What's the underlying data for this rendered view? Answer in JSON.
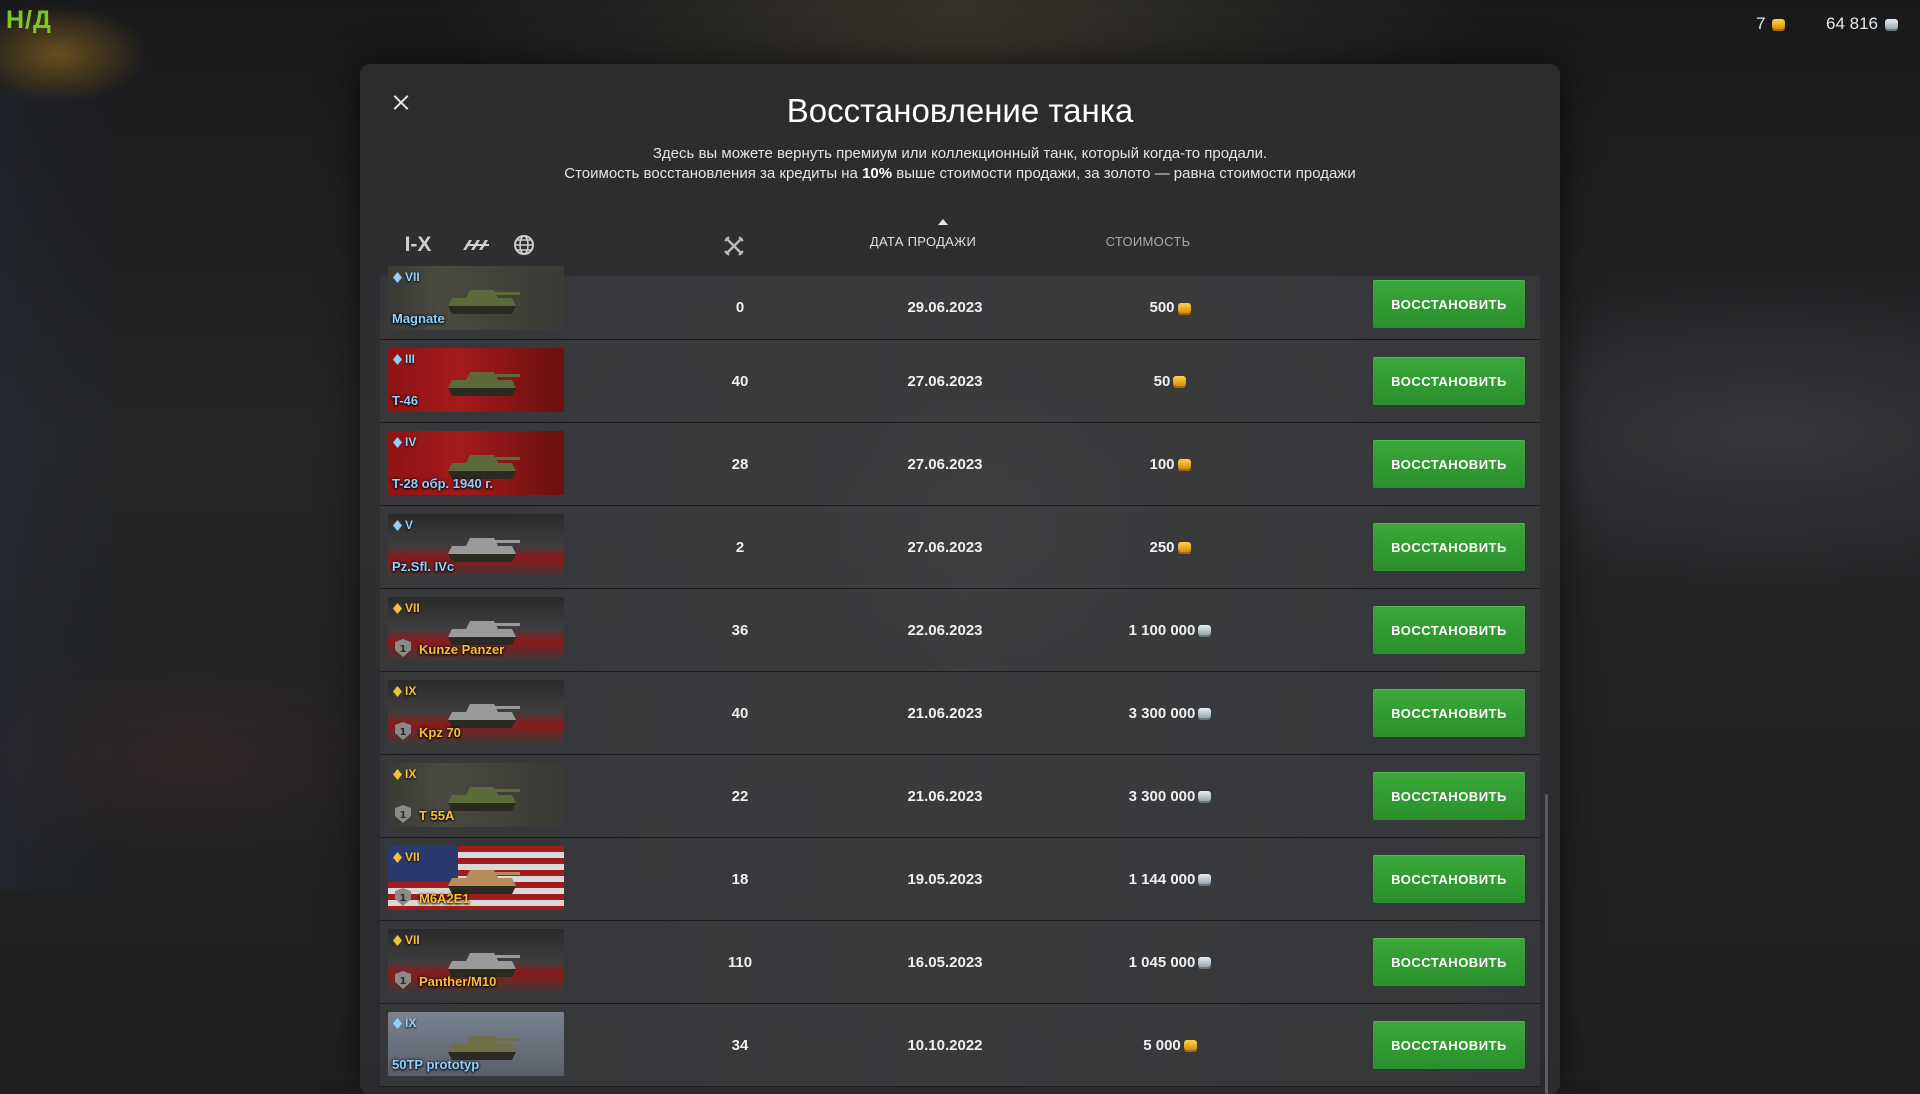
{
  "hud": {
    "na_label": "Н/Д",
    "gold_amount": "7",
    "credits_amount": "64 816"
  },
  "modal": {
    "title": "Восстановление танка",
    "desc_line1": "Здесь вы можете вернуть премиум или коллекционный танк, который когда-то продали.",
    "desc_line2_pre": "Стоимость восстановления за кредиты на ",
    "desc_line2_bold": "10%",
    "desc_line2_post": " выше стоимости продажи, за золото — равна стоимости продажи"
  },
  "filters": {
    "tier_label": "I-X",
    "type_icon": "tank-type-icon",
    "nation_icon": "globe-icon"
  },
  "columns": {
    "battles_icon": "crossed-swords-icon",
    "date": "ДАТА ПРОДАЖИ",
    "cost": "СТОИМОСТЬ"
  },
  "button_label": "ВОССТАНОВИТЬ",
  "rows": [
    {
      "tier": "VII",
      "name": "Magnate",
      "kind": "premium",
      "nation": "china",
      "battles": "0",
      "date": "29.06.2023",
      "cost": "500",
      "currency": "gold"
    },
    {
      "tier": "III",
      "name": "T-46",
      "kind": "premium",
      "nation": "ussr",
      "battles": "40",
      "date": "27.06.2023",
      "cost": "50",
      "currency": "gold"
    },
    {
      "tier": "IV",
      "name": "T-28 обр. 1940 г.",
      "kind": "premium",
      "nation": "ussr",
      "battles": "28",
      "date": "27.06.2023",
      "cost": "100",
      "currency": "gold"
    },
    {
      "tier": "V",
      "name": "Pz.Sfl. IVc",
      "kind": "premium",
      "nation": "germany",
      "battles": "2",
      "date": "27.06.2023",
      "cost": "250",
      "currency": "gold"
    },
    {
      "tier": "VII",
      "name": "Kunze Panzer",
      "kind": "collector",
      "nation": "germany",
      "battles": "36",
      "date": "22.06.2023",
      "cost": "1 100 000",
      "currency": "credits"
    },
    {
      "tier": "IX",
      "name": "Kpz 70",
      "kind": "collector",
      "nation": "germany",
      "battles": "40",
      "date": "21.06.2023",
      "cost": "3 300 000",
      "currency": "credits"
    },
    {
      "tier": "IX",
      "name": "T 55A",
      "kind": "collector",
      "nation": "china",
      "battles": "22",
      "date": "21.06.2023",
      "cost": "3 300 000",
      "currency": "credits"
    },
    {
      "tier": "VII",
      "name": "M6A2E1",
      "kind": "collector",
      "nation": "usa",
      "battles": "18",
      "date": "19.05.2023",
      "cost": "1 144 000",
      "currency": "credits"
    },
    {
      "tier": "VII",
      "name": "Panther/M10",
      "kind": "collector",
      "nation": "germany",
      "battles": "110",
      "date": "16.05.2023",
      "cost": "1 045 000",
      "currency": "credits"
    },
    {
      "tier": "IX",
      "name": "50TP prototyp",
      "kind": "premium",
      "nation": "poland",
      "battles": "34",
      "date": "10.10.2022",
      "cost": "5 000",
      "currency": "gold"
    }
  ],
  "colors": {
    "accent_green": "#2f9a31",
    "premium_name": "#8fd0ff",
    "collector_name": "#f5c13a",
    "na_green": "#7ec81e"
  }
}
